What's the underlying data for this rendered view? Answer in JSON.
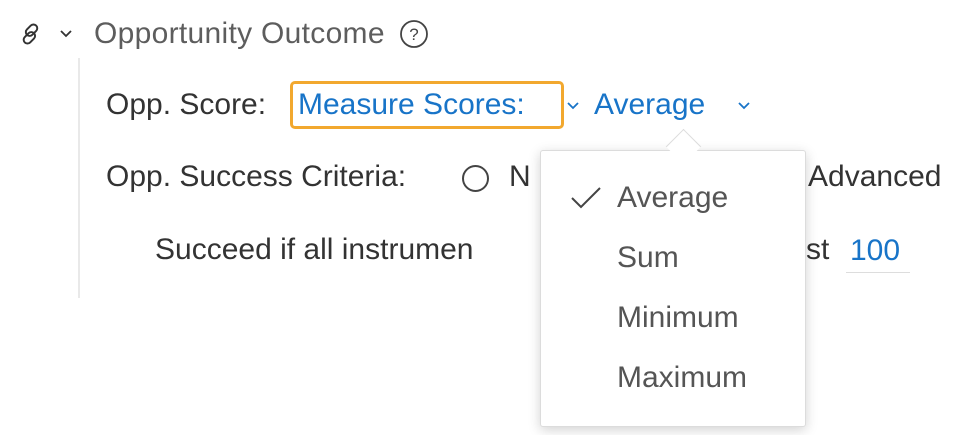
{
  "section": {
    "title": "Opportunity Outcome",
    "icons": {
      "link": "link-icon",
      "collapse": "chevron-down-icon",
      "help": "help-circle-icon"
    }
  },
  "score_row": {
    "label": "Opp. Score:",
    "measure_label": "Measure Scores:",
    "aggregate_value": "Average"
  },
  "criteria_row": {
    "label": "Opp. Success Criteria:",
    "option_none_partial": "N",
    "option_advanced": "Advanced"
  },
  "succeed_row": {
    "text_left": "Succeed if all instrumen",
    "text_right": "st",
    "threshold_value": "100"
  },
  "dropdown": {
    "selected": "Average",
    "options": [
      "Average",
      "Sum",
      "Minimum",
      "Maximum"
    ]
  },
  "colors": {
    "accent": "#1874c8",
    "highlight": "#f2a82e"
  }
}
